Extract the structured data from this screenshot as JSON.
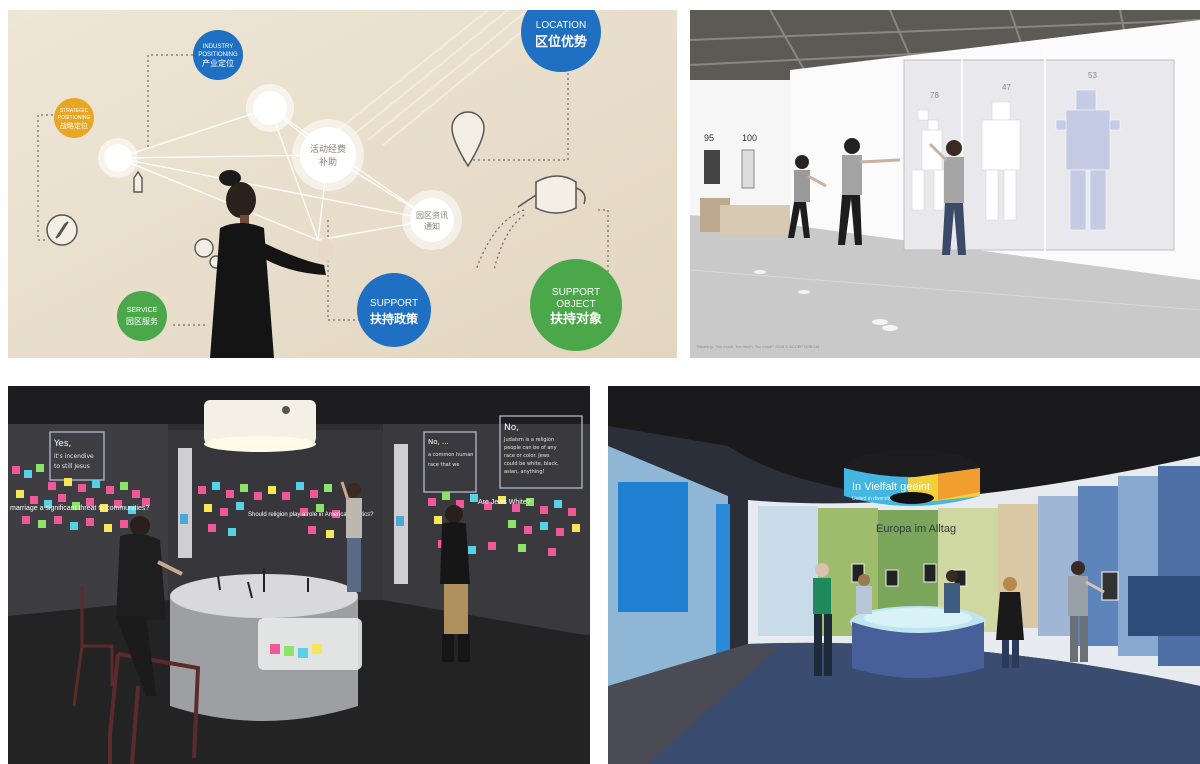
{
  "panel1": {
    "circle_industry": [
      "INDUSTRY",
      "POSITIONING",
      "产业定位"
    ],
    "circle_strategic": [
      "STRATEGIC",
      "POSITIONING",
      "战略定位"
    ],
    "circle_location": [
      "LOCATION",
      "区位优势"
    ],
    "circle_service": [
      "SERVICE",
      "园区服务"
    ],
    "circle_support": [
      "SUPPORT",
      "扶持政策"
    ],
    "circle_support_object": [
      "SUPPORT",
      "OBJECT",
      "扶持对象"
    ],
    "node_center": [
      "活动经费",
      "补助"
    ],
    "node_right": [
      "园区资讯",
      "通知"
    ]
  },
  "panel2": {
    "height_labels": [
      "95",
      "100"
    ],
    "screen_numbers": [
      "78",
      "47",
      "53"
    ],
    "caption": "\"Meaning: 'Too much, Too much, Too much'\" 2016 © ACCEPTION Ltd"
  },
  "panel3": {
    "board_left": [
      "Yes,",
      "it's incendive",
      "to still Jesus"
    ],
    "board_mid": [
      "No, ...",
      "a common human",
      "race that we"
    ],
    "board_right": [
      "No,",
      "Judaism is a religion",
      "people can be of any",
      "race or color. Jews",
      "could be white, black,",
      "asian, anything!"
    ],
    "question_marriage": "marriage a significant threat to communities?",
    "question_politics": "Should religion play a role in American politics?",
    "question_white": "Are Jews White?"
  },
  "panel4": {
    "ring_text": "In Vielfalt geeint",
    "ring_subtext": "United in diversity",
    "wall_title": "Europa im Alltag"
  },
  "colors": {
    "blue": "#1f6fc2",
    "orange": "#e9a524",
    "green": "#4aa84a",
    "wood": "#ece3d3"
  }
}
